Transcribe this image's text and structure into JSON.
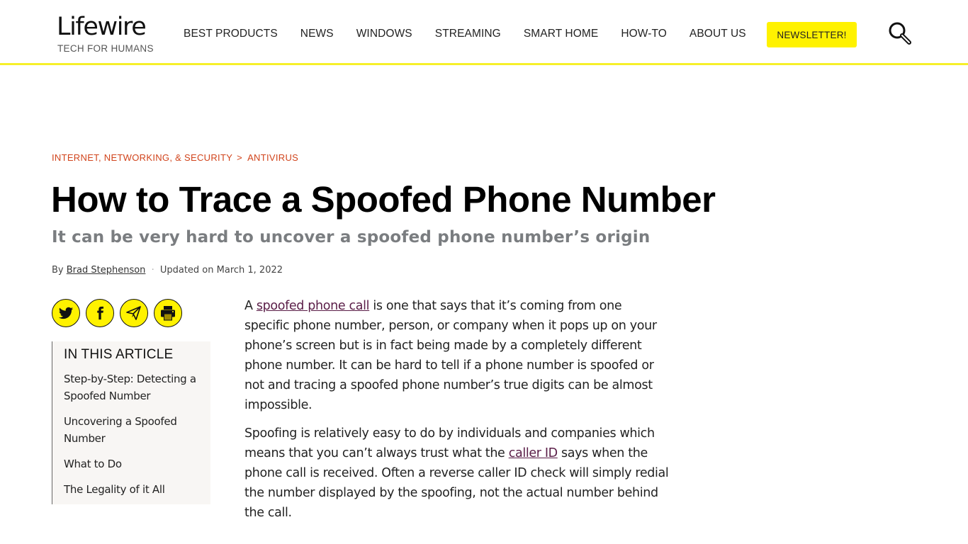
{
  "header": {
    "logo": "Lifewire",
    "tagline": "TECH FOR HUMANS",
    "nav": [
      "BEST PRODUCTS",
      "NEWS",
      "WINDOWS",
      "STREAMING",
      "SMART HOME",
      "HOW-TO",
      "ABOUT US"
    ],
    "newsletter_label": "NEWSLETTER!",
    "search_icon": "search-icon",
    "accent_color": "#fff200"
  },
  "breadcrumb": {
    "items": [
      "INTERNET, NETWORKING, & SECURITY",
      "ANTIVIRUS"
    ],
    "separator": ">",
    "color": "#d1441c"
  },
  "article": {
    "title": "How to Trace a Spoofed Phone Number",
    "subtitle": "It can be very hard to uncover a spoofed phone number’s origin",
    "byline": {
      "by": "By",
      "author": "Brad Stephenson",
      "separator": "·",
      "updated": "Updated on March 1, 2022"
    },
    "social": [
      "twitter-icon",
      "facebook-icon",
      "email-share-icon",
      "print-icon"
    ],
    "toc": {
      "title": "IN THIS ARTICLE",
      "items": [
        "Step-by-Step: Detecting a Spoofed Number",
        "Uncovering a Spoofed Number",
        "What to Do",
        "The Legality of it All"
      ]
    },
    "paragraphs": [
      {
        "pre": "A ",
        "link": "spoofed phone call",
        "post": " is one that says that it’s coming from one specific phone number, person, or company when it pops up on your phone’s screen but is in fact being made by a completely different phone number. It can be hard to tell if a phone number is spoofed or not and tracing a spoofed phone number’s true digits can be almost impossible."
      },
      {
        "pre": "Spoofing is relatively easy to do by individuals and companies which means that you can’t always trust what the ",
        "link": "caller ID",
        "post": " says when the phone call is received. Often a reverse caller ID check will simply redial the number displayed by the spoofing, not the actual number behind the call."
      }
    ]
  }
}
